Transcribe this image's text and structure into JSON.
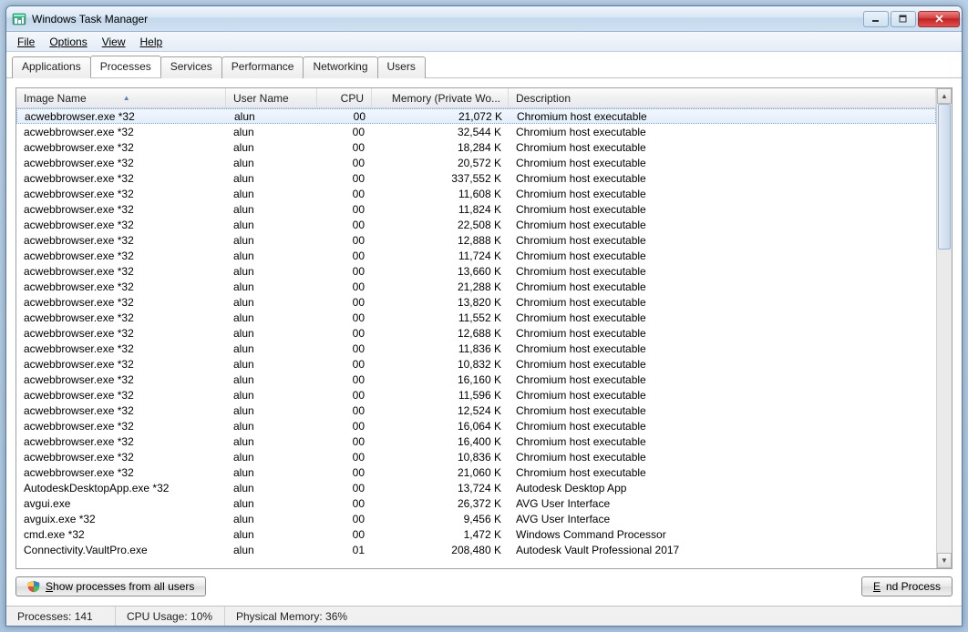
{
  "window": {
    "title": "Windows Task Manager"
  },
  "menu": {
    "file": "File",
    "options": "Options",
    "view": "View",
    "help": "Help"
  },
  "tabs": {
    "applications": "Applications",
    "processes": "Processes",
    "services": "Services",
    "performance": "Performance",
    "networking": "Networking",
    "users": "Users"
  },
  "columns": {
    "image_name": "Image Name",
    "user_name": "User Name",
    "cpu": "CPU",
    "memory": "Memory (Private Wo...",
    "description": "Description"
  },
  "processes": [
    {
      "img": "acwebbrowser.exe *32",
      "user": "alun",
      "cpu": "00",
      "mem": "21,072 K",
      "desc": "Chromium host executable",
      "selected": true
    },
    {
      "img": "acwebbrowser.exe *32",
      "user": "alun",
      "cpu": "00",
      "mem": "32,544 K",
      "desc": "Chromium host executable"
    },
    {
      "img": "acwebbrowser.exe *32",
      "user": "alun",
      "cpu": "00",
      "mem": "18,284 K",
      "desc": "Chromium host executable"
    },
    {
      "img": "acwebbrowser.exe *32",
      "user": "alun",
      "cpu": "00",
      "mem": "20,572 K",
      "desc": "Chromium host executable"
    },
    {
      "img": "acwebbrowser.exe *32",
      "user": "alun",
      "cpu": "00",
      "mem": "337,552 K",
      "desc": "Chromium host executable"
    },
    {
      "img": "acwebbrowser.exe *32",
      "user": "alun",
      "cpu": "00",
      "mem": "11,608 K",
      "desc": "Chromium host executable"
    },
    {
      "img": "acwebbrowser.exe *32",
      "user": "alun",
      "cpu": "00",
      "mem": "11,824 K",
      "desc": "Chromium host executable"
    },
    {
      "img": "acwebbrowser.exe *32",
      "user": "alun",
      "cpu": "00",
      "mem": "22,508 K",
      "desc": "Chromium host executable"
    },
    {
      "img": "acwebbrowser.exe *32",
      "user": "alun",
      "cpu": "00",
      "mem": "12,888 K",
      "desc": "Chromium host executable"
    },
    {
      "img": "acwebbrowser.exe *32",
      "user": "alun",
      "cpu": "00",
      "mem": "11,724 K",
      "desc": "Chromium host executable"
    },
    {
      "img": "acwebbrowser.exe *32",
      "user": "alun",
      "cpu": "00",
      "mem": "13,660 K",
      "desc": "Chromium host executable"
    },
    {
      "img": "acwebbrowser.exe *32",
      "user": "alun",
      "cpu": "00",
      "mem": "21,288 K",
      "desc": "Chromium host executable"
    },
    {
      "img": "acwebbrowser.exe *32",
      "user": "alun",
      "cpu": "00",
      "mem": "13,820 K",
      "desc": "Chromium host executable"
    },
    {
      "img": "acwebbrowser.exe *32",
      "user": "alun",
      "cpu": "00",
      "mem": "11,552 K",
      "desc": "Chromium host executable"
    },
    {
      "img": "acwebbrowser.exe *32",
      "user": "alun",
      "cpu": "00",
      "mem": "12,688 K",
      "desc": "Chromium host executable"
    },
    {
      "img": "acwebbrowser.exe *32",
      "user": "alun",
      "cpu": "00",
      "mem": "11,836 K",
      "desc": "Chromium host executable"
    },
    {
      "img": "acwebbrowser.exe *32",
      "user": "alun",
      "cpu": "00",
      "mem": "10,832 K",
      "desc": "Chromium host executable"
    },
    {
      "img": "acwebbrowser.exe *32",
      "user": "alun",
      "cpu": "00",
      "mem": "16,160 K",
      "desc": "Chromium host executable"
    },
    {
      "img": "acwebbrowser.exe *32",
      "user": "alun",
      "cpu": "00",
      "mem": "11,596 K",
      "desc": "Chromium host executable"
    },
    {
      "img": "acwebbrowser.exe *32",
      "user": "alun",
      "cpu": "00",
      "mem": "12,524 K",
      "desc": "Chromium host executable"
    },
    {
      "img": "acwebbrowser.exe *32",
      "user": "alun",
      "cpu": "00",
      "mem": "16,064 K",
      "desc": "Chromium host executable"
    },
    {
      "img": "acwebbrowser.exe *32",
      "user": "alun",
      "cpu": "00",
      "mem": "16,400 K",
      "desc": "Chromium host executable"
    },
    {
      "img": "acwebbrowser.exe *32",
      "user": "alun",
      "cpu": "00",
      "mem": "10,836 K",
      "desc": "Chromium host executable"
    },
    {
      "img": "acwebbrowser.exe *32",
      "user": "alun",
      "cpu": "00",
      "mem": "21,060 K",
      "desc": "Chromium host executable"
    },
    {
      "img": "AutodeskDesktopApp.exe *32",
      "user": "alun",
      "cpu": "00",
      "mem": "13,724 K",
      "desc": "Autodesk Desktop App"
    },
    {
      "img": "avgui.exe",
      "user": "alun",
      "cpu": "00",
      "mem": "26,372 K",
      "desc": "AVG User Interface"
    },
    {
      "img": "avguix.exe *32",
      "user": "alun",
      "cpu": "00",
      "mem": "9,456 K",
      "desc": "AVG User Interface"
    },
    {
      "img": "cmd.exe *32",
      "user": "alun",
      "cpu": "00",
      "mem": "1,472 K",
      "desc": "Windows Command Processor"
    },
    {
      "img": "Connectivity.VaultPro.exe",
      "user": "alun",
      "cpu": "01",
      "mem": "208,480 K",
      "desc": "Autodesk Vault Professional 2017"
    }
  ],
  "buttons": {
    "show_all": "Show processes from all users",
    "end_process": "End Process"
  },
  "status": {
    "processes": "Processes: 141",
    "cpu": "CPU Usage: 10%",
    "memory": "Physical Memory: 36%"
  }
}
